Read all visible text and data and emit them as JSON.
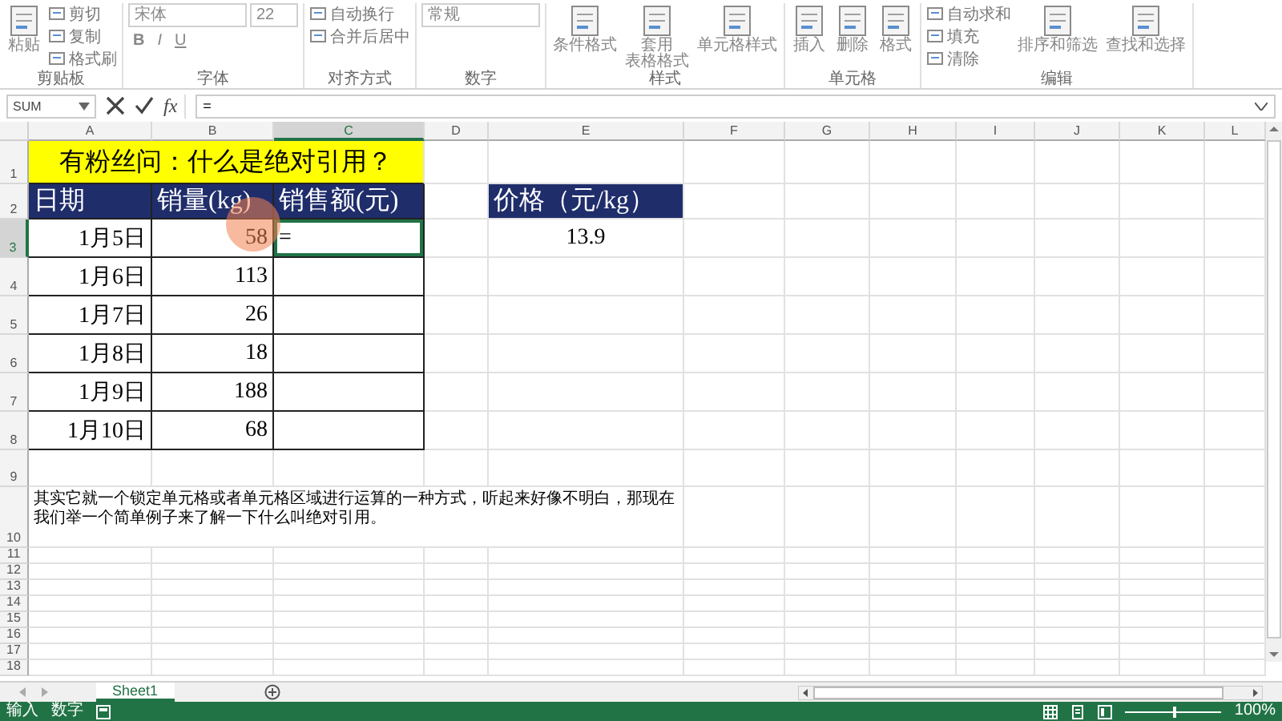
{
  "ribbon": {
    "groups": [
      {
        "label": "剪贴板",
        "columns": [
          [
            {
              "kind": "large",
              "lines": [
                "粘贴"
              ]
            }
          ],
          [
            {
              "kind": "small",
              "label": "剪切"
            },
            {
              "kind": "small",
              "label": "复制"
            },
            {
              "kind": "small",
              "label": "格式刷"
            }
          ]
        ]
      },
      {
        "label": "字体",
        "columns": [
          [
            [
              {
                "kind": "field",
                "label": "宋体",
                "wide": true
              },
              {
                "kind": "field",
                "label": "22",
                "wide": false
              }
            ],
            [
              {
                "kind": "glyph",
                "label": "B"
              },
              {
                "kind": "glyph",
                "label": "I"
              },
              {
                "kind": "glyph",
                "label": "U"
              }
            ]
          ]
        ]
      },
      {
        "label": "对齐方式",
        "columns": [
          [
            {
              "kind": "small",
              "label": "自动换行"
            },
            {
              "kind": "small",
              "label": "合并后居中"
            }
          ]
        ]
      },
      {
        "label": "数字",
        "columns": [
          [
            {
              "kind": "field",
              "label": "常规",
              "wide": true
            }
          ]
        ]
      },
      {
        "label": "样式",
        "columns": [
          [
            {
              "kind": "large",
              "lines": [
                "条件格式"
              ]
            }
          ],
          [
            {
              "kind": "large",
              "lines": [
                "套用",
                "表格格式"
              ]
            }
          ],
          [
            {
              "kind": "large",
              "lines": [
                "单元格样式"
              ]
            }
          ]
        ]
      },
      {
        "label": "单元格",
        "columns": [
          [
            {
              "kind": "large",
              "lines": [
                "插入"
              ]
            }
          ],
          [
            {
              "kind": "large",
              "lines": [
                "删除"
              ]
            }
          ],
          [
            {
              "kind": "large",
              "lines": [
                "格式"
              ]
            }
          ]
        ]
      },
      {
        "label": "编辑",
        "columns": [
          [
            {
              "kind": "small",
              "label": "自动求和"
            },
            {
              "kind": "small",
              "label": "填充"
            },
            {
              "kind": "small",
              "label": "清除"
            }
          ],
          [
            {
              "kind": "large",
              "lines": [
                "排序和筛选"
              ]
            }
          ],
          [
            {
              "kind": "large",
              "lines": [
                "查找和选择"
              ]
            }
          ]
        ]
      }
    ]
  },
  "formula_bar": {
    "name_box": "SUM",
    "function_label": "fx",
    "formula": "="
  },
  "columns": [
    "A",
    "B",
    "C",
    "D",
    "E",
    "F",
    "G",
    "H",
    "I",
    "J",
    "K",
    "L"
  ],
  "rows": [
    {
      "label": "1",
      "framed": false,
      "cells": [
        {
          "kind": "title",
          "text": "有粉丝问：什么是绝对引用？",
          "selected": false
        }
      ]
    },
    {
      "label": "2",
      "framed": true,
      "cells": [
        {
          "kind": "header",
          "text": "日期",
          "selected": false
        },
        {
          "kind": "header",
          "text": "销量(kg)",
          "selected": false
        },
        {
          "kind": "header",
          "text": "销售额(元)",
          "selected": false
        },
        null,
        {
          "kind": "header",
          "text": "价格（元/kg）",
          "selected": false
        }
      ]
    },
    {
      "label": "3",
      "framed": true,
      "cells": [
        {
          "kind": "value",
          "text": "1月5日",
          "selected": false
        },
        {
          "kind": "value",
          "text": "58",
          "selected": false
        },
        {
          "kind": "entry",
          "text": "=",
          "selected": true
        },
        null,
        {
          "kind": "centered",
          "text": "13.9",
          "selected": false
        }
      ]
    },
    {
      "label": "4",
      "framed": true,
      "cells": [
        {
          "kind": "value",
          "text": "1月6日",
          "selected": false
        },
        {
          "kind": "value",
          "text": "113",
          "selected": false
        }
      ]
    },
    {
      "label": "5",
      "framed": true,
      "cells": [
        {
          "kind": "value",
          "text": "1月7日",
          "selected": false
        },
        {
          "kind": "value",
          "text": "26",
          "selected": false
        }
      ]
    },
    {
      "label": "6",
      "framed": true,
      "cells": [
        {
          "kind": "value",
          "text": "1月8日",
          "selected": false
        },
        {
          "kind": "value",
          "text": "18",
          "selected": false
        }
      ]
    },
    {
      "label": "7",
      "framed": true,
      "cells": [
        {
          "kind": "value",
          "text": "1月9日",
          "selected": false
        },
        {
          "kind": "value",
          "text": "188",
          "selected": false
        }
      ]
    },
    {
      "label": "8",
      "framed": true,
      "cells": [
        {
          "kind": "value",
          "text": "1月10日",
          "selected": false
        },
        {
          "kind": "value",
          "text": "68",
          "selected": false
        }
      ]
    },
    {
      "label": "9",
      "framed": false,
      "cells": []
    },
    {
      "label": "10",
      "framed": false,
      "cells": [
        {
          "kind": "note",
          "text": "其实它就一个锁定单元格或者单元格区域进行运算的一种方式，听起来好像不明白，那现在我们举一个简单例子来了解一下什么叫绝对引用。",
          "selected": false
        }
      ]
    },
    {
      "label": "11",
      "framed": false,
      "cells": []
    },
    {
      "label": "12",
      "framed": false,
      "cells": []
    },
    {
      "label": "13",
      "framed": false,
      "cells": []
    },
    {
      "label": "14",
      "framed": false,
      "cells": []
    },
    {
      "label": "15",
      "framed": false,
      "cells": []
    },
    {
      "label": "16",
      "framed": false,
      "cells": []
    },
    {
      "label": "17",
      "framed": false,
      "cells": []
    },
    {
      "label": "18",
      "framed": false,
      "cells": []
    }
  ],
  "sheet_tabs": [
    {
      "label": "Sheet1",
      "selected": true
    }
  ],
  "status_bar": {
    "mode": "输入",
    "indicator": "数字",
    "zoom": {
      "level": 0.5,
      "reading": "100%"
    }
  }
}
